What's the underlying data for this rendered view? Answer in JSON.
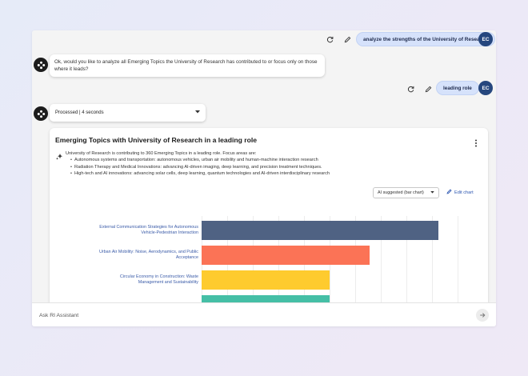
{
  "conversation": {
    "user_message_1": {
      "text": "analyze the strengths of the University of Research",
      "avatar": "EC"
    },
    "assistant_message_1": "Ok, would you like to analyze all Emerging Topics the University of Research has contributed to or focus only on those where it leads?",
    "user_message_2": {
      "text": "leading role",
      "avatar": "EC"
    },
    "processed_status": "Processed | 4 seconds"
  },
  "card": {
    "title": "Emerging Topics with University of Research in a leading role",
    "summary_intro": "University of Research is contributing to 360 Emerging Topics in a leading role. Focus areas are:",
    "focus_areas": [
      "Autonomous systems and transportation: autonomous vehicles, urban air mobility and human-machine interaction research",
      "Radiation Therapy and Medical Innovations: advancing AI-driven imaging, deep learning, and precision treatment techniques.",
      "High-tech and AI innovations: advancing solar cells, deep learning, quantum technologies and AI-driven interdisciplinary research"
    ],
    "chart_type_select": "AI suggested (bar chart)",
    "edit_chart_label": "Edit chart"
  },
  "chart_data": {
    "type": "bar",
    "orientation": "horizontal",
    "categories": [
      "External Communication Strategies for Autonomous Vehicle-Pedestrian Interaction",
      "Urban Air Mobility: Noise, Aerodynamics, and Public Acceptance",
      "Circular Economy in Construction: Waste Management and Sustainability",
      ""
    ],
    "values": [
      100,
      71,
      54,
      54
    ],
    "colors": [
      "#4f6283",
      "#fb7356",
      "#fecb2e",
      "#45bfa6"
    ],
    "grid": true
  },
  "input": {
    "placeholder": "Ask RI Assistant"
  },
  "icons": {
    "regenerate": "refresh-icon",
    "edit": "pencil-icon",
    "assistant": "assistant-logo-icon",
    "sparkle": "sparkle-icon",
    "send": "arrow-right-icon"
  }
}
